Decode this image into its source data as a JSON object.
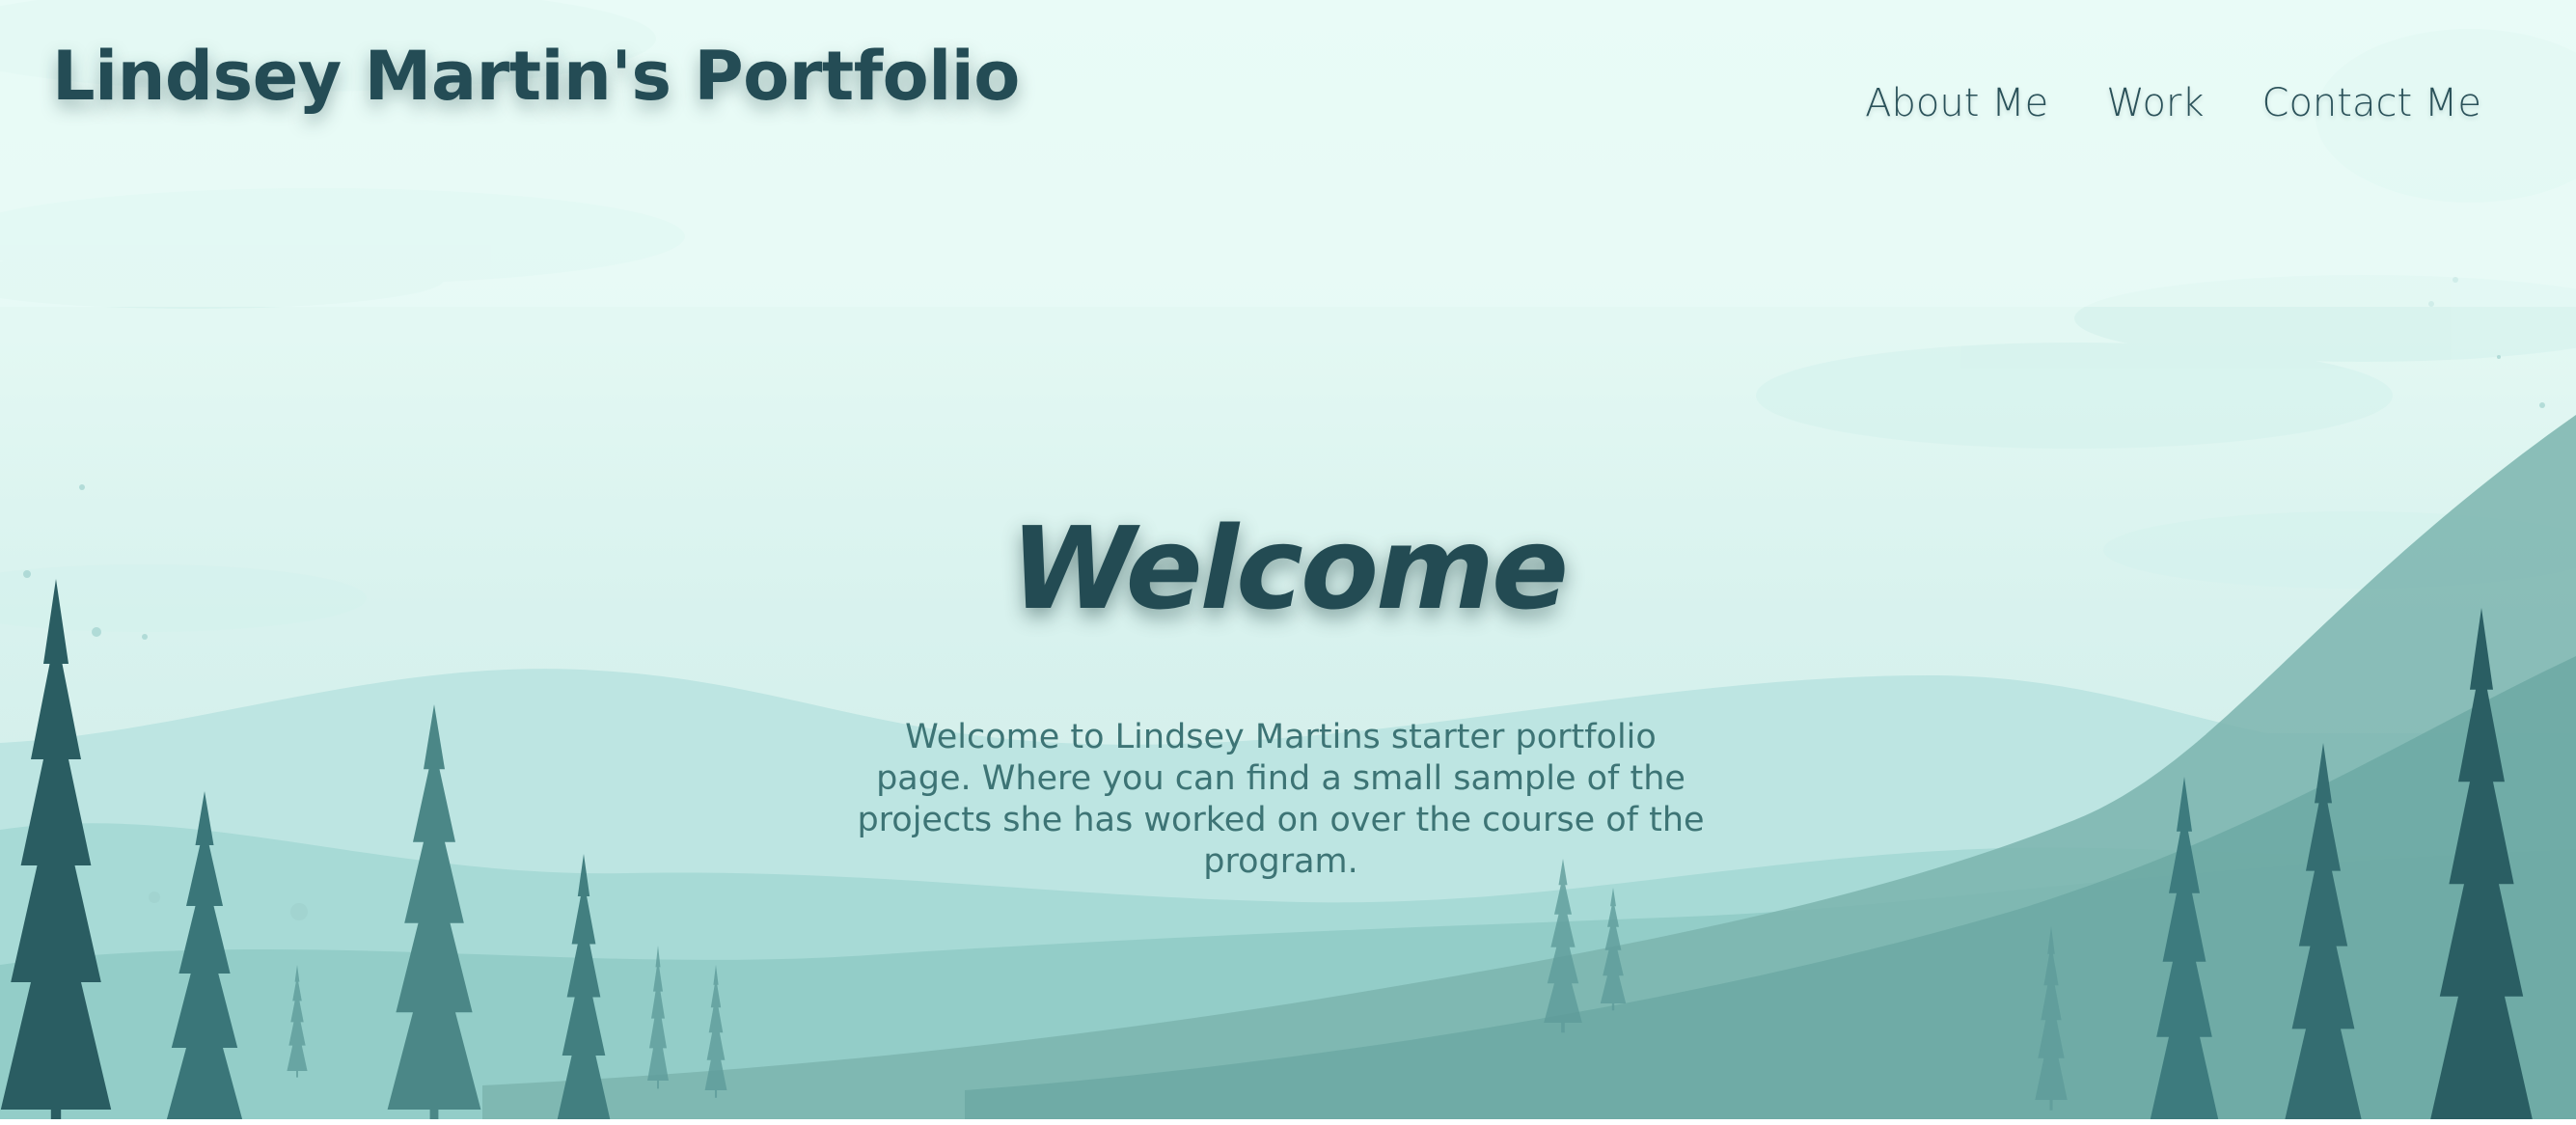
{
  "header": {
    "site_title": "Lindsey Martin's Portfolio",
    "nav": [
      {
        "label": "About Me"
      },
      {
        "label": "Work"
      },
      {
        "label": "Contact Me"
      }
    ]
  },
  "hero": {
    "heading": "Welcome",
    "description": "Welcome to Lindsey Martins starter portfolio page. Where you can find a small sample of the projects she has worked on over the course of the program.",
    "background_image": "watercolor-mountain-forest-landscape"
  },
  "colors": {
    "sky": "#e6fbf5",
    "heading_text": "#244c55",
    "body_text": "#3d7475",
    "tree_dark": "#27595e",
    "tree_mid": "#3f7d80"
  }
}
